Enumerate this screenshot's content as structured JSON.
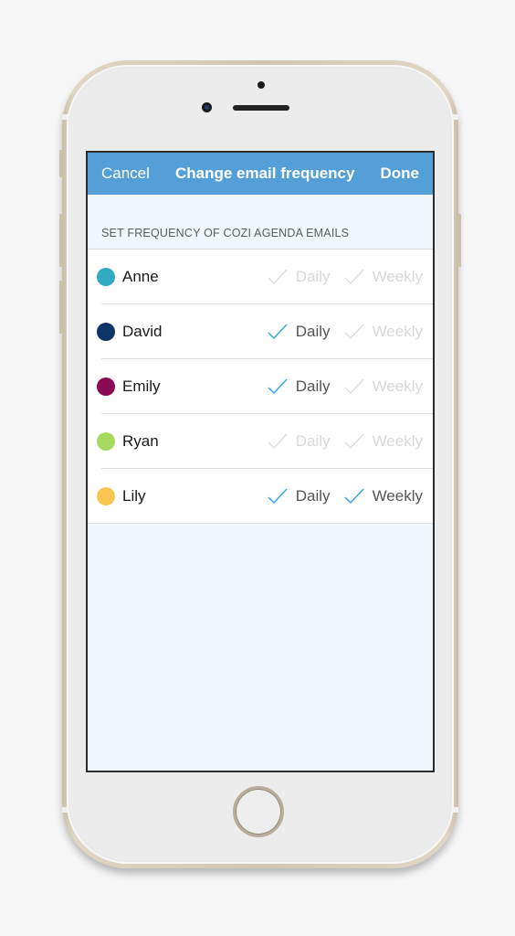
{
  "navbar": {
    "cancel_label": "Cancel",
    "title": "Change email frequency",
    "done_label": "Done",
    "background_color": "#549fd8"
  },
  "section": {
    "header": "SET FREQUENCY OF COZI AGENDA EMAILS"
  },
  "options": {
    "daily_label": "Daily",
    "weekly_label": "Weekly",
    "checked_color": "#2fa6e0",
    "unchecked_color": "#dcdcdc"
  },
  "members": [
    {
      "name": "Anne",
      "color": "#32a9c2",
      "daily": false,
      "weekly": false
    },
    {
      "name": "David",
      "color": "#0d3568",
      "daily": true,
      "weekly": false
    },
    {
      "name": "Emily",
      "color": "#8a0a55",
      "daily": true,
      "weekly": false
    },
    {
      "name": "Ryan",
      "color": "#a6d95e",
      "daily": false,
      "weekly": false
    },
    {
      "name": "Lily",
      "color": "#f9c550",
      "daily": true,
      "weekly": true
    }
  ]
}
